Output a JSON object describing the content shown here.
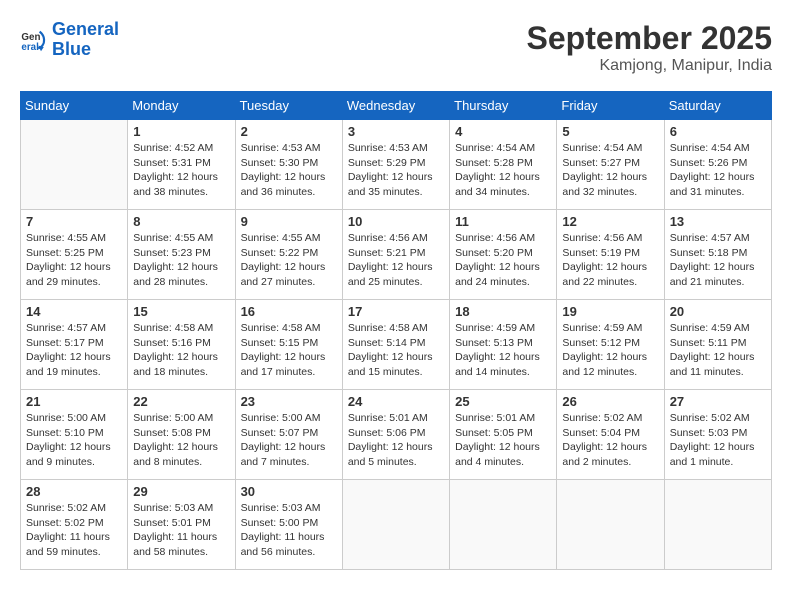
{
  "header": {
    "logo_line1": "General",
    "logo_line2": "Blue",
    "month": "September 2025",
    "location": "Kamjong, Manipur, India"
  },
  "weekdays": [
    "Sunday",
    "Monday",
    "Tuesday",
    "Wednesday",
    "Thursday",
    "Friday",
    "Saturday"
  ],
  "weeks": [
    [
      {
        "day": "",
        "info": ""
      },
      {
        "day": "1",
        "info": "Sunrise: 4:52 AM\nSunset: 5:31 PM\nDaylight: 12 hours\nand 38 minutes."
      },
      {
        "day": "2",
        "info": "Sunrise: 4:53 AM\nSunset: 5:30 PM\nDaylight: 12 hours\nand 36 minutes."
      },
      {
        "day": "3",
        "info": "Sunrise: 4:53 AM\nSunset: 5:29 PM\nDaylight: 12 hours\nand 35 minutes."
      },
      {
        "day": "4",
        "info": "Sunrise: 4:54 AM\nSunset: 5:28 PM\nDaylight: 12 hours\nand 34 minutes."
      },
      {
        "day": "5",
        "info": "Sunrise: 4:54 AM\nSunset: 5:27 PM\nDaylight: 12 hours\nand 32 minutes."
      },
      {
        "day": "6",
        "info": "Sunrise: 4:54 AM\nSunset: 5:26 PM\nDaylight: 12 hours\nand 31 minutes."
      }
    ],
    [
      {
        "day": "7",
        "info": "Sunrise: 4:55 AM\nSunset: 5:25 PM\nDaylight: 12 hours\nand 29 minutes."
      },
      {
        "day": "8",
        "info": "Sunrise: 4:55 AM\nSunset: 5:23 PM\nDaylight: 12 hours\nand 28 minutes."
      },
      {
        "day": "9",
        "info": "Sunrise: 4:55 AM\nSunset: 5:22 PM\nDaylight: 12 hours\nand 27 minutes."
      },
      {
        "day": "10",
        "info": "Sunrise: 4:56 AM\nSunset: 5:21 PM\nDaylight: 12 hours\nand 25 minutes."
      },
      {
        "day": "11",
        "info": "Sunrise: 4:56 AM\nSunset: 5:20 PM\nDaylight: 12 hours\nand 24 minutes."
      },
      {
        "day": "12",
        "info": "Sunrise: 4:56 AM\nSunset: 5:19 PM\nDaylight: 12 hours\nand 22 minutes."
      },
      {
        "day": "13",
        "info": "Sunrise: 4:57 AM\nSunset: 5:18 PM\nDaylight: 12 hours\nand 21 minutes."
      }
    ],
    [
      {
        "day": "14",
        "info": "Sunrise: 4:57 AM\nSunset: 5:17 PM\nDaylight: 12 hours\nand 19 minutes."
      },
      {
        "day": "15",
        "info": "Sunrise: 4:58 AM\nSunset: 5:16 PM\nDaylight: 12 hours\nand 18 minutes."
      },
      {
        "day": "16",
        "info": "Sunrise: 4:58 AM\nSunset: 5:15 PM\nDaylight: 12 hours\nand 17 minutes."
      },
      {
        "day": "17",
        "info": "Sunrise: 4:58 AM\nSunset: 5:14 PM\nDaylight: 12 hours\nand 15 minutes."
      },
      {
        "day": "18",
        "info": "Sunrise: 4:59 AM\nSunset: 5:13 PM\nDaylight: 12 hours\nand 14 minutes."
      },
      {
        "day": "19",
        "info": "Sunrise: 4:59 AM\nSunset: 5:12 PM\nDaylight: 12 hours\nand 12 minutes."
      },
      {
        "day": "20",
        "info": "Sunrise: 4:59 AM\nSunset: 5:11 PM\nDaylight: 12 hours\nand 11 minutes."
      }
    ],
    [
      {
        "day": "21",
        "info": "Sunrise: 5:00 AM\nSunset: 5:10 PM\nDaylight: 12 hours\nand 9 minutes."
      },
      {
        "day": "22",
        "info": "Sunrise: 5:00 AM\nSunset: 5:08 PM\nDaylight: 12 hours\nand 8 minutes."
      },
      {
        "day": "23",
        "info": "Sunrise: 5:00 AM\nSunset: 5:07 PM\nDaylight: 12 hours\nand 7 minutes."
      },
      {
        "day": "24",
        "info": "Sunrise: 5:01 AM\nSunset: 5:06 PM\nDaylight: 12 hours\nand 5 minutes."
      },
      {
        "day": "25",
        "info": "Sunrise: 5:01 AM\nSunset: 5:05 PM\nDaylight: 12 hours\nand 4 minutes."
      },
      {
        "day": "26",
        "info": "Sunrise: 5:02 AM\nSunset: 5:04 PM\nDaylight: 12 hours\nand 2 minutes."
      },
      {
        "day": "27",
        "info": "Sunrise: 5:02 AM\nSunset: 5:03 PM\nDaylight: 12 hours\nand 1 minute."
      }
    ],
    [
      {
        "day": "28",
        "info": "Sunrise: 5:02 AM\nSunset: 5:02 PM\nDaylight: 11 hours\nand 59 minutes."
      },
      {
        "day": "29",
        "info": "Sunrise: 5:03 AM\nSunset: 5:01 PM\nDaylight: 11 hours\nand 58 minutes."
      },
      {
        "day": "30",
        "info": "Sunrise: 5:03 AM\nSunset: 5:00 PM\nDaylight: 11 hours\nand 56 minutes."
      },
      {
        "day": "",
        "info": ""
      },
      {
        "day": "",
        "info": ""
      },
      {
        "day": "",
        "info": ""
      },
      {
        "day": "",
        "info": ""
      }
    ]
  ]
}
